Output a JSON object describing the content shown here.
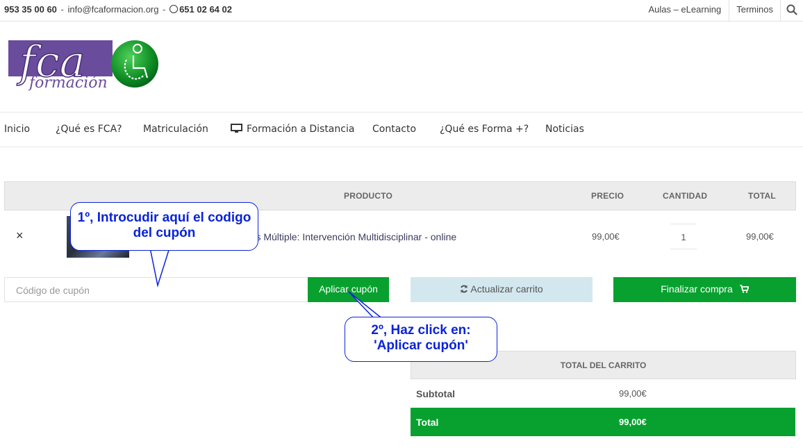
{
  "topbar": {
    "phone": "953 35 00 60",
    "sep1": "-",
    "email": "info@fcaformacion.org",
    "sep2": "-",
    "whatsapp": "651 02 64 02",
    "links": [
      "Aulas – eLearning",
      "Terminos"
    ]
  },
  "logo": {
    "text_main": "fca",
    "text_sub": "formación"
  },
  "nav": {
    "items": [
      "Inicio",
      "¿Qué es FCA?",
      "Matriculación",
      "Formación a Distancia",
      "Contacto",
      "¿Qué es Forma +?",
      "Noticias"
    ]
  },
  "cart": {
    "headers": {
      "product": "PRODUCTO",
      "price": "PRECIO",
      "quantity": "CANTIDAD",
      "total": "TOTAL"
    },
    "item": {
      "remove": "×",
      "name": "clerosis Múltiple: Intervención Multidisciplinar - online",
      "price": "99,00€",
      "quantity": "1",
      "total": "99,00€"
    },
    "coupon_placeholder": "Código de cupón",
    "apply_label": "Aplicar cupón",
    "update_label": "Actualizar carrito",
    "checkout_label": "Finalizar compra"
  },
  "totals": {
    "title": "TOTAL DEL CARRITO",
    "subtotal_label": "Subtotal",
    "subtotal_value": "99,00€",
    "total_label": "Total",
    "total_value": "99,00€"
  },
  "callouts": {
    "first_line1": "1º, Introcudir aquí el codigo",
    "first_line2": "del cupón",
    "second_line1": "2º, Haz click en:",
    "second_line2": "'Aplicar cupón'"
  },
  "colors": {
    "brand_green": "#08a12f",
    "update_button": "#d3e7ee",
    "callout_blue": "#0a23d9",
    "logo_purple": "#6a4c9c"
  }
}
